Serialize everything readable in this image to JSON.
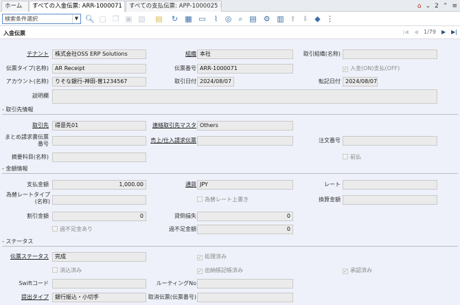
{
  "tabs": {
    "home": "ホーム",
    "tab1": "すべての入金伝票: ARR-1000071",
    "tab2": "すべての支払伝票: APP-1000025",
    "close": "✖",
    "notif_count": "2"
  },
  "toolbar": {
    "search_placeholder": "検索条件選択"
  },
  "header": {
    "title": "入金伝票",
    "record_position": "1/79"
  },
  "form": {
    "tenant_label": "テナント",
    "tenant_value": "株式会社OSS ERP Solutions",
    "org_label": "組織",
    "org_value": "本社",
    "trx_org_label": "取引組織(名称)",
    "trx_org_value": "",
    "doctype_label": "伝票タイプ(名称)",
    "doctype_value": "AR Receipt",
    "docno_label": "伝票番号",
    "docno_value": "ARR-1000071",
    "receipt_chk": "入金(ON)支払(OFF)",
    "account_label": "アカウント(名称)",
    "account_value": "りそな銀行-神田-普1234567",
    "trxdate_label": "取引日付",
    "trxdate_value": "2024/08/07",
    "acctdate_label": "転記日付",
    "acctdate_value": "2024/08/07",
    "desc_label": "説明欄",
    "desc_value": "",
    "section_bp": "- 取引先情報",
    "bp_label": "取引先",
    "bp_value": "得意先01",
    "bpcontact_label": "連絡取引先マスタ",
    "bpcontact_value": "Others",
    "invoice_batch_label": "まとめ請求書伝票番号",
    "invoice_batch_value": "",
    "invoice_label": "売上/仕入請求伝票",
    "invoice_value": "",
    "order_label": "注文番号",
    "order_value": "",
    "charge_label": "摘要科目(名称)",
    "charge_value": "",
    "prepay_chk": "前払",
    "section_amount": "- 金額情報",
    "payamt_label": "支払金額",
    "payamt_value": "1,000.00",
    "currency_label": "通貨",
    "currency_value": "JPY",
    "rate_label": "レート",
    "rate_value": "",
    "conv_type_label": "為替レートタイプ(名称)",
    "conv_type_value": "",
    "override_chk": "為替レート上書き",
    "conv_amt_label": "換算金額",
    "conv_amt_value": "",
    "discount_label": "割引金額",
    "discount_value": "0",
    "writeoff_label": "貸倒損失",
    "writeoff_value": "0",
    "overunder_chk": "過不足金あり",
    "overunder_label": "過不足金額",
    "overunder_value": "0",
    "section_status": "- ステータス",
    "docstatus_label": "伝票ステータス",
    "docstatus_value": "完成",
    "processed_chk": "処理済み",
    "reconciled_chk": "消込済み",
    "onstatement_chk": "出納帳記帳済み",
    "approved_chk": "承認済み",
    "swift_label": "Swiftコード",
    "swift_value": "",
    "routing_label": "ルーティングNo",
    "routing_value": "",
    "tender_label": "提出タイプ",
    "tender_value": "銀行振込・小切手",
    "reversal_label": "取消伝票(伝票番号)",
    "reversal_value": ""
  }
}
